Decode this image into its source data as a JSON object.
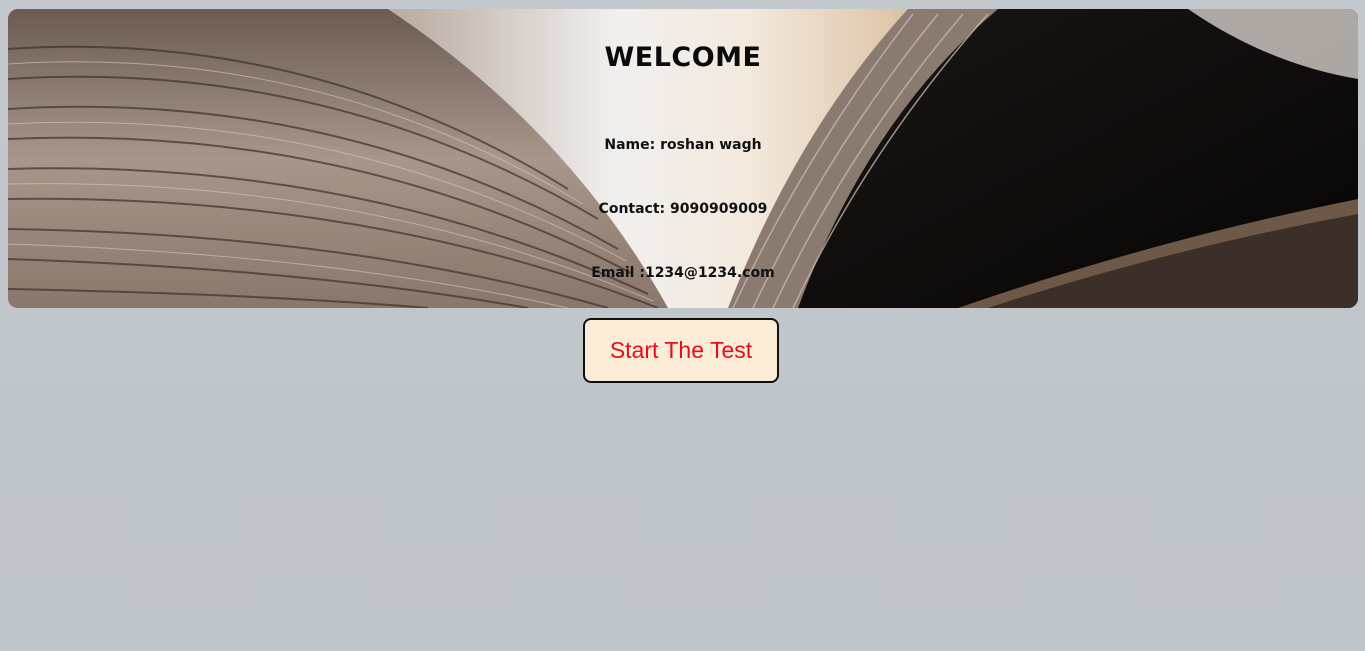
{
  "banner": {
    "title": "WELCOME",
    "name_label": "Name:",
    "name_value": "roshan wagh",
    "contact_label": "Contact:",
    "contact_value": "9090909009",
    "email_label": "Email :",
    "email_value": "1234@1234.com",
    "background": "open-book-photo"
  },
  "actions": {
    "start_label": "Start The Test"
  },
  "colors": {
    "button_bg": "#fcebd7",
    "button_text": "#e2101a",
    "page_bg": "#c2c7cc"
  }
}
